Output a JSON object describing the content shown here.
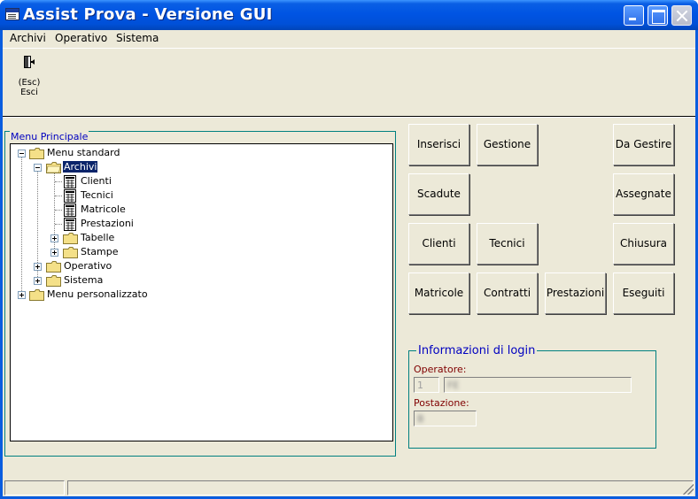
{
  "window": {
    "title": "Assist Prova - Versione GUI"
  },
  "menubar": {
    "items": [
      "Archivi",
      "Operativo",
      "Sistema"
    ]
  },
  "toolbar": {
    "esc": {
      "line1": "(Esc)",
      "line2": "Esci",
      "icon": "exit-door-icon"
    }
  },
  "menu_panel": {
    "caption": "Menu Principale",
    "tree": [
      {
        "label": "Menu standard",
        "expanded": true,
        "icon": "folder-icon"
      },
      {
        "label": "Archivi",
        "expanded": true,
        "selected": true,
        "icon": "folder-open-icon"
      },
      {
        "label": "Clienti",
        "icon": "document-icon"
      },
      {
        "label": "Tecnici",
        "icon": "document-icon"
      },
      {
        "label": "Matricole",
        "icon": "document-icon"
      },
      {
        "label": "Prestazioni",
        "icon": "document-icon"
      },
      {
        "label": "Tabelle",
        "expanded": false,
        "icon": "folder-icon"
      },
      {
        "label": "Stampe",
        "expanded": false,
        "icon": "folder-icon"
      },
      {
        "label": "Operativo",
        "expanded": false,
        "icon": "folder-icon"
      },
      {
        "label": "Sistema",
        "expanded": false,
        "icon": "folder-icon"
      },
      {
        "label": "Menu personalizzato",
        "expanded": false,
        "icon": "folder-icon"
      }
    ]
  },
  "buttons": {
    "inserisci": "Inserisci",
    "gestione": "Gestione",
    "da_gestire": "Da Gestire",
    "scadute": "Scadute",
    "assegnate": "Assegnate",
    "clienti": "Clienti",
    "tecnici": "Tecnici",
    "chiusura": "Chiusura",
    "matricole": "Matricole",
    "contratti": "Contratti",
    "prestazioni": "Prestazioni",
    "eseguiti": "Eseguiti"
  },
  "login": {
    "caption": "Informazioni di login",
    "operatore_label": "Operatore:",
    "operatore_id": "1",
    "operatore_name": "FE",
    "postazione_label": "Postazione:",
    "postazione_value": "B"
  },
  "colors": {
    "titlebar": "#0054e3",
    "panel": "#ece9d8",
    "group_border": "#008080",
    "caption_text": "#0000c0",
    "field_label": "#800000",
    "selection": "#0a246a"
  }
}
